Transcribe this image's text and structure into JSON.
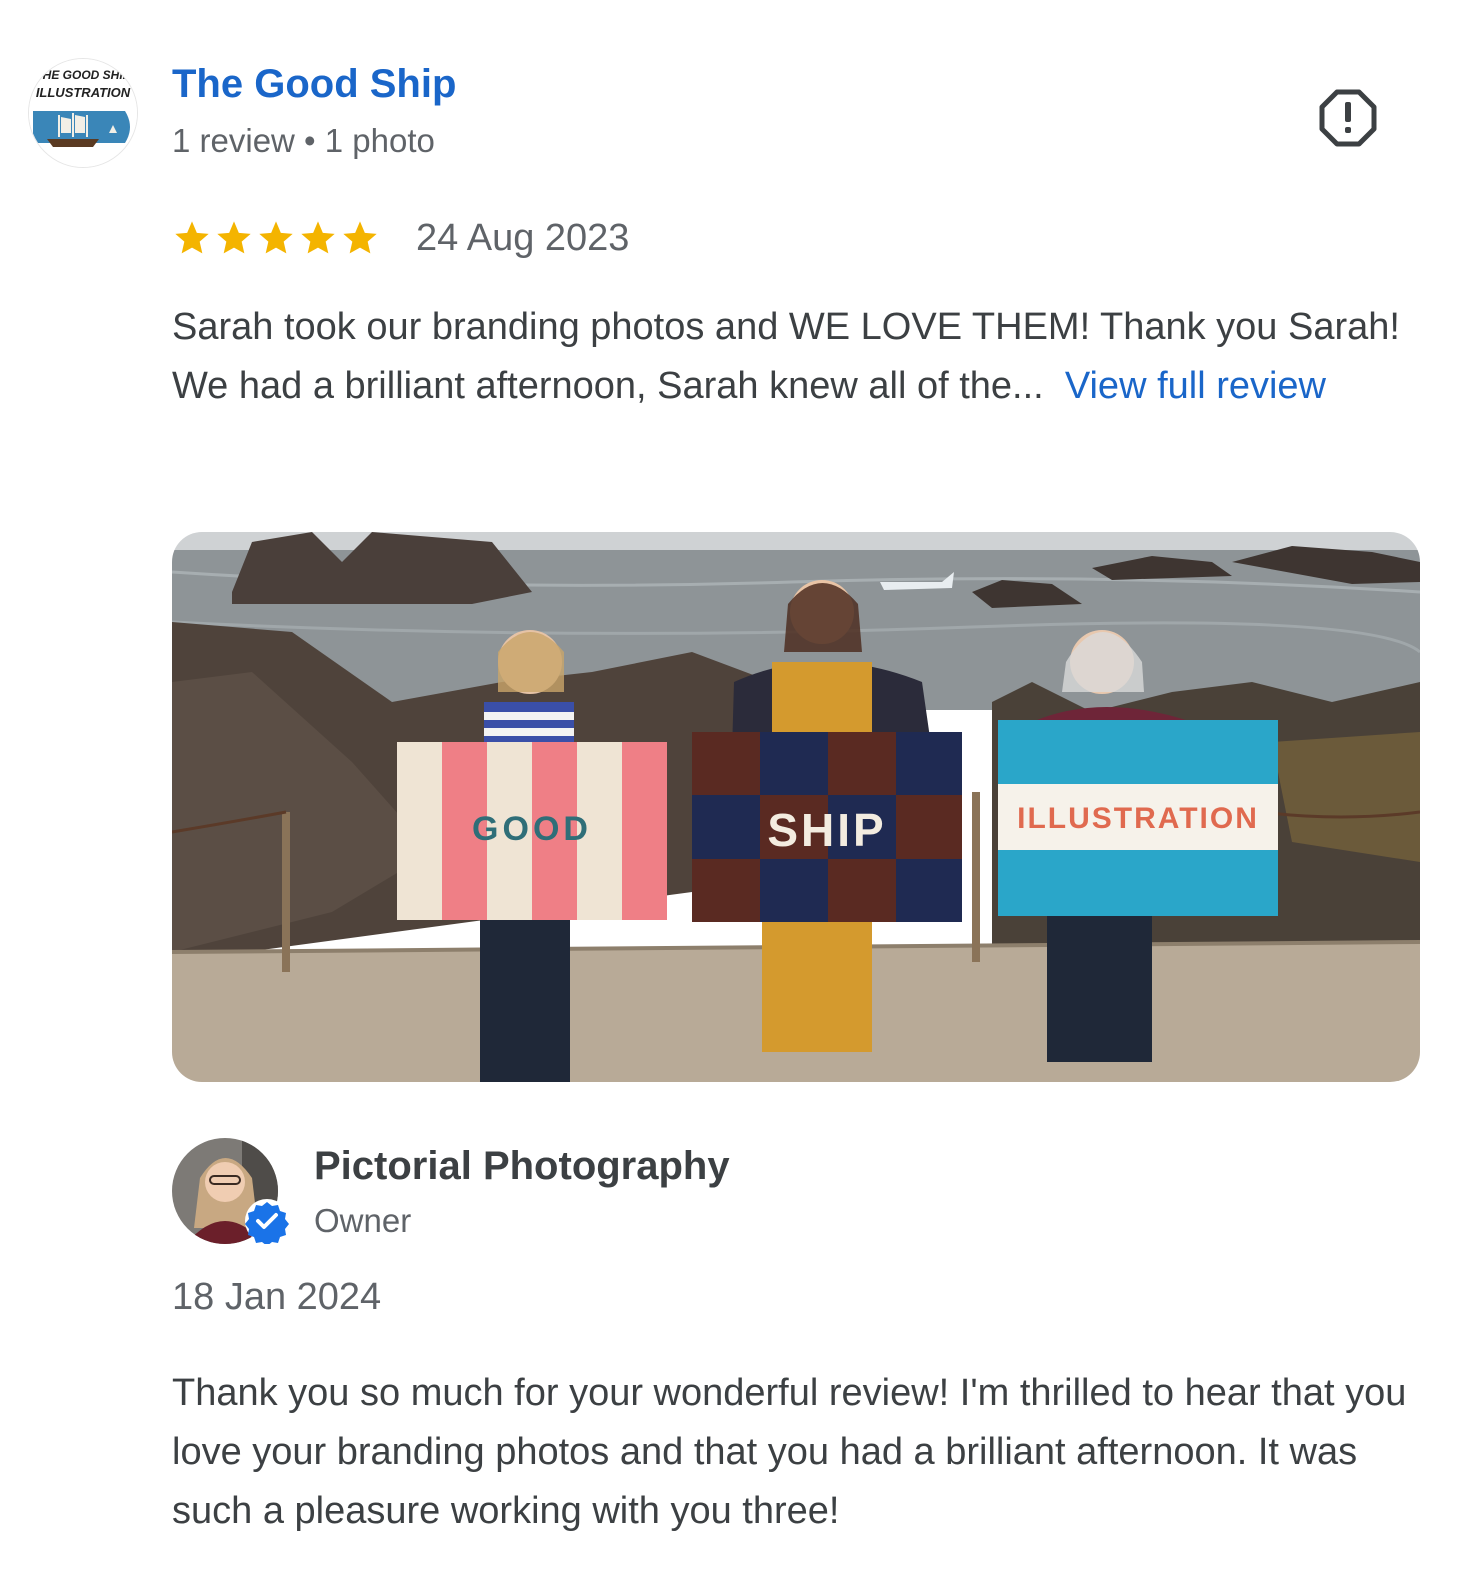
{
  "reviewer": {
    "name": "The Good Ship",
    "meta": "1 review • 1 photo",
    "logo_line1": "THE GOOD SHIP",
    "logo_line2": "ILLUSTRATION"
  },
  "review": {
    "rating": 5,
    "rating_max": 5,
    "date": "24 Aug 2023",
    "text": "Sarah took our branding photos and WE LOVE THEM! Thank you Sarah! We had a brilliant afternoon, Sarah knew all of the...",
    "more_link": "View full review"
  },
  "photo": {
    "flags": [
      "GOOD",
      "SHIP",
      "ILLUSTRATION"
    ]
  },
  "owner_reply": {
    "name": "Pictorial Photography",
    "role": "Owner",
    "date": "18 Jan 2024",
    "text": "Thank you so much for your wonderful review! I'm thrilled to hear that you love your branding photos and that you had a brilliant afternoon. It was such a pleasure working with you three!"
  },
  "icons": {
    "report": "report-icon",
    "star": "star-icon",
    "verified": "verified-badge-icon"
  },
  "colors": {
    "link": "#1a66c9",
    "star": "#f4b400",
    "verified": "#1a73e8"
  }
}
